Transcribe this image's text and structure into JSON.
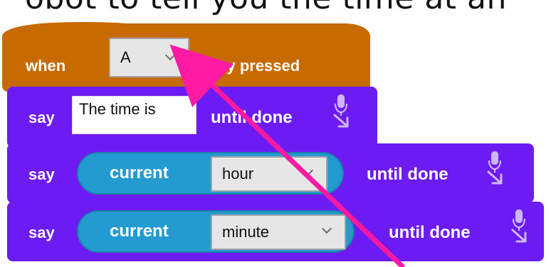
{
  "caption": "obot to tell you the time at an",
  "hat_block": {
    "label_when": "when",
    "key_selected": "A",
    "label_key_pressed": "key pressed"
  },
  "blocks": [
    {
      "say": "say",
      "text": "The time is",
      "until_done": "until done"
    },
    {
      "say": "say",
      "reporter_label": "current",
      "reporter_value": "hour",
      "until_done": "until done"
    },
    {
      "say": "say",
      "reporter_label": "current",
      "reporter_value": "minute",
      "until_done": "until done"
    }
  ],
  "colors": {
    "hat": "#c76a00",
    "block": "#6d1bf3",
    "reporter": "#239bd0",
    "annotation_arrow": "#ff1aa3"
  },
  "icons": {
    "dropdown": "chevron-down-icon",
    "speech": "mic-icon",
    "annotation": "arrow-pointer-icon"
  }
}
